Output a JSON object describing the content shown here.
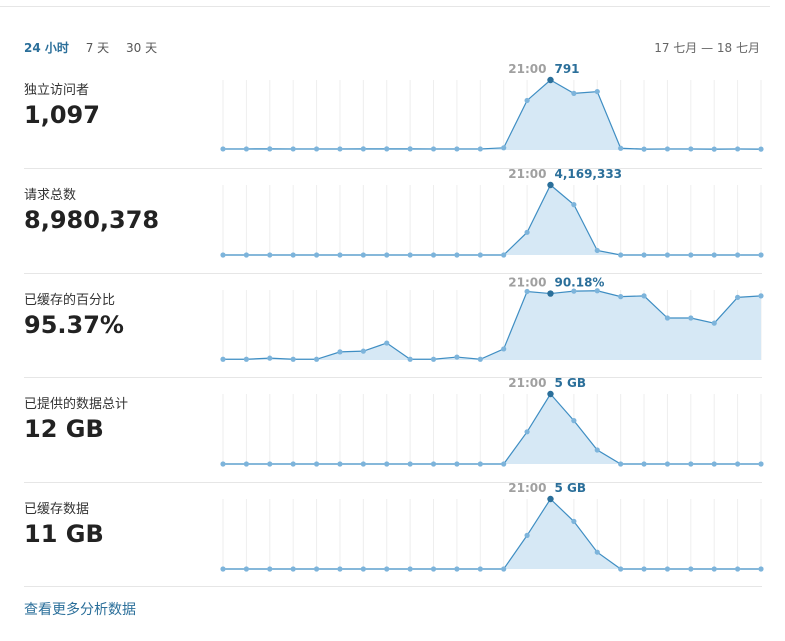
{
  "tabs": [
    {
      "label": "24 小时",
      "active": true
    },
    {
      "label": "7 天",
      "active": false
    },
    {
      "label": "30 天",
      "active": false
    }
  ],
  "date_range": "17 七月 — 18 七月",
  "colors": {
    "accent": "#2b6f9a",
    "line": "#3f8ec3",
    "fill": "#d6e8f5",
    "point": "#7db4db",
    "grid": "#eeeeee"
  },
  "metrics": [
    {
      "label": "独立访问者",
      "value": "1,097",
      "tooltip": {
        "time": "21:00",
        "value": "791",
        "index": 14
      },
      "series": [
        12,
        12,
        13,
        12,
        12,
        12,
        13,
        13,
        13,
        12,
        12,
        12,
        25,
        560,
        791,
        640,
        660,
        20,
        10,
        12,
        12,
        10,
        12,
        10
      ],
      "ymax": 791
    },
    {
      "label": "请求总数",
      "value": "8,980,378",
      "tooltip": {
        "time": "21:00",
        "value": "4,169,333",
        "index": 14
      },
      "series": [
        0,
        0,
        0,
        0,
        0,
        0,
        0,
        0,
        0,
        0,
        0,
        0,
        0,
        1350000,
        4169333,
        3000000,
        270000,
        0,
        0,
        0,
        0,
        0,
        0,
        0
      ],
      "ymax": 4169333
    },
    {
      "label": "已缓存的百分比",
      "value": "95.37%",
      "tooltip": {
        "time": "21:00",
        "value": "90.18%",
        "index": 14
      },
      "series": [
        1,
        1,
        2.5,
        1,
        1,
        11,
        12,
        23,
        1,
        1,
        4,
        1,
        15,
        93,
        90.18,
        93.5,
        94,
        86,
        87,
        57,
        57,
        50,
        85,
        87
      ],
      "ymax": 95
    },
    {
      "label": "已提供的数据总计",
      "value": "12 GB",
      "tooltip": {
        "time": "21:00",
        "value": "5 GB",
        "index": 14
      },
      "series": [
        0,
        0,
        0,
        0,
        0,
        0,
        0,
        0,
        0,
        0,
        0,
        0,
        0,
        2.3,
        5,
        3.1,
        1.0,
        0,
        0,
        0,
        0,
        0,
        0,
        0
      ],
      "ymax": 5
    },
    {
      "label": "已缓存数据",
      "value": "11 GB",
      "tooltip": {
        "time": "21:00",
        "value": "5 GB",
        "index": 14
      },
      "series": [
        0,
        0,
        0,
        0,
        0,
        0,
        0,
        0,
        0,
        0,
        0,
        0,
        0,
        2.4,
        5,
        3.4,
        1.2,
        0,
        0,
        0,
        0,
        0,
        0,
        0
      ],
      "ymax": 5
    }
  ],
  "more_link": "查看更多分析数据"
}
